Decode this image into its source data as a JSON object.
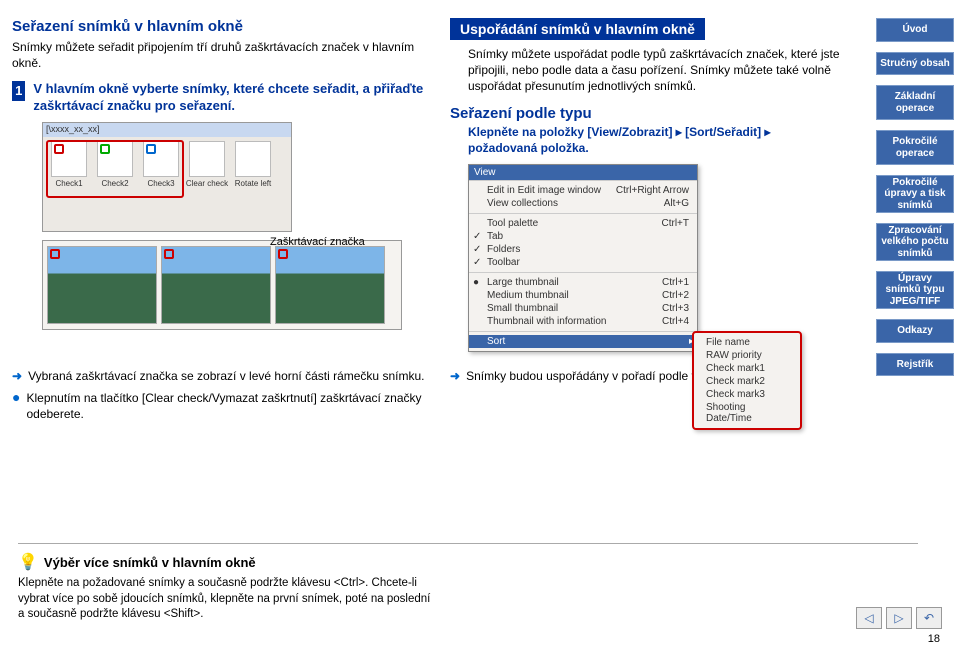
{
  "left": {
    "title": "Seřazení snímků v hlavním okně",
    "intro": "Snímky můžete seřadit připojením tří druhů zaškrtávacích značek v hlavním okně.",
    "step_num": "1",
    "step_text": "V hlavním okně vyberte snímky, které chcete seřadit, a přiřaďte zaškrtávací značku pro seřazení.",
    "titlebar": "[\\xxxx_xx_xx]",
    "tb": [
      {
        "label": "Check1"
      },
      {
        "label": "Check2"
      },
      {
        "label": "Check3"
      },
      {
        "label": "Clear check"
      },
      {
        "label": "Rotate left"
      }
    ],
    "callout": "Zaškrtávací značka",
    "bullets": [
      {
        "icon": "arrow",
        "text": "Vybraná zaškrtávací značka se zobrazí v levé horní části rámečku snímku."
      },
      {
        "icon": "dot",
        "text": "Klepnutím na tlačítko [Clear check/Vymazat zaškrtnutí] zaškrtávací značky odeberete."
      }
    ]
  },
  "right": {
    "title_bg": "Uspořádání snímků v hlavním okně",
    "intro": "Snímky můžete uspořádat podle typů zaškrtávacích značek, které jste připojili, nebo podle data a času pořízení. Snímky můžete také volně uspořádat přesunutím jednotlivých snímků.",
    "sec1": "Seřazení podle typu",
    "sec1_step": "Klepněte na položky [View/Zobrazit] ▸ [Sort/Seřadit] ▸ požadovaná položka.",
    "menu_hdr": "View",
    "menu_items1": [
      {
        "label": "Edit in Edit image window",
        "accel": "Ctrl+Right Arrow"
      },
      {
        "label": "View collections",
        "accel": "Alt+G"
      }
    ],
    "menu_items2": [
      {
        "label": "Tool palette",
        "accel": "Ctrl+T"
      },
      {
        "label": "Tab",
        "chk": true
      },
      {
        "label": "Folders",
        "chk": true
      },
      {
        "label": "Toolbar",
        "chk": true
      }
    ],
    "menu_items3": [
      {
        "label": "Large thumbnail",
        "accel": "Ctrl+1",
        "chk": true
      },
      {
        "label": "Medium thumbnail",
        "accel": "Ctrl+2"
      },
      {
        "label": "Small thumbnail",
        "accel": "Ctrl+3"
      },
      {
        "label": "Thumbnail with information",
        "accel": "Ctrl+4"
      }
    ],
    "menu_items4": [
      {
        "label": "Sort",
        "sub": true,
        "hover": true
      }
    ],
    "submenu": [
      "File name",
      "RAW priority",
      "Check mark1",
      "Check mark2",
      "Check mark3",
      "Shooting Date/Time"
    ],
    "result": "Snímky budou uspořádány v pořadí podle vybrané položky."
  },
  "sidebar": {
    "items": [
      "Úvod",
      "Stručný obsah",
      "Základní operace",
      "Pokročilé operace",
      "Pokročilé úpravy a tisk snímků",
      "Zpracování velkého počtu snímků",
      "Úpravy snímků typu JPEG/TIFF",
      "Odkazy",
      "Rejstřík"
    ]
  },
  "tip": {
    "title": "Výběr více snímků v hlavním okně",
    "body": "Klepněte na požadované snímky a současně podržte klávesu <Ctrl>. Chcete-li vybrat více po sobě jdoucích snímků, klepněte na první snímek, poté na poslední a současně podržte klávesu <Shift>."
  },
  "page_num": "18"
}
